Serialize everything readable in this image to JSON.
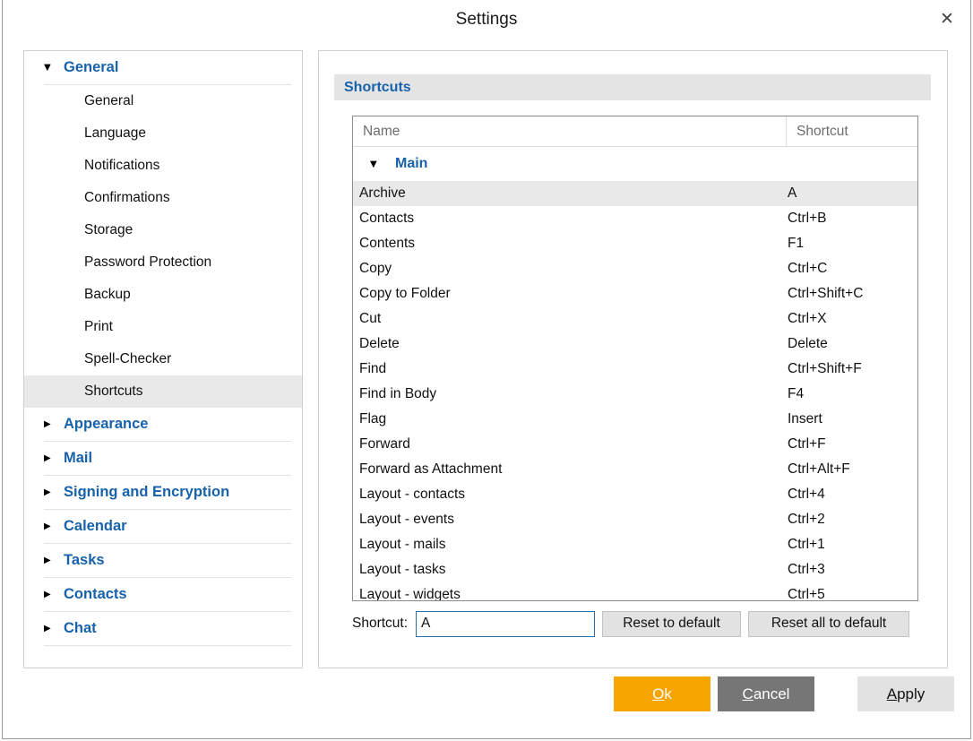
{
  "window": {
    "title": "Settings",
    "close_icon": "close-icon",
    "close_glyph": "✕"
  },
  "sidebar": {
    "groups": [
      {
        "label": "General",
        "expanded": true,
        "triangle": "▼",
        "items": [
          {
            "label": "General",
            "selected": false
          },
          {
            "label": "Language",
            "selected": false
          },
          {
            "label": "Notifications",
            "selected": false
          },
          {
            "label": "Confirmations",
            "selected": false
          },
          {
            "label": "Storage",
            "selected": false
          },
          {
            "label": "Password Protection",
            "selected": false
          },
          {
            "label": "Backup",
            "selected": false
          },
          {
            "label": "Print",
            "selected": false
          },
          {
            "label": "Spell-Checker",
            "selected": false
          },
          {
            "label": "Shortcuts",
            "selected": true
          }
        ]
      },
      {
        "label": "Appearance",
        "expanded": false,
        "triangle": "▶",
        "items": []
      },
      {
        "label": "Mail",
        "expanded": false,
        "triangle": "▶",
        "items": []
      },
      {
        "label": "Signing and Encryption",
        "expanded": false,
        "triangle": "▶",
        "items": []
      },
      {
        "label": "Calendar",
        "expanded": false,
        "triangle": "▶",
        "items": []
      },
      {
        "label": "Tasks",
        "expanded": false,
        "triangle": "▶",
        "items": []
      },
      {
        "label": "Contacts",
        "expanded": false,
        "triangle": "▶",
        "items": []
      },
      {
        "label": "Chat",
        "expanded": false,
        "triangle": "▶",
        "items": []
      }
    ]
  },
  "panel": {
    "header": "Shortcuts",
    "table": {
      "columns": [
        "Name",
        "Shortcut"
      ],
      "group": {
        "label": "Main",
        "triangle": "▼",
        "expanded": true
      },
      "rows": [
        {
          "name": "Archive",
          "shortcut": "A",
          "selected": true
        },
        {
          "name": "Contacts",
          "shortcut": "Ctrl+B",
          "selected": false
        },
        {
          "name": "Contents",
          "shortcut": "F1",
          "selected": false
        },
        {
          "name": "Copy",
          "shortcut": "Ctrl+C",
          "selected": false
        },
        {
          "name": "Copy to Folder",
          "shortcut": "Ctrl+Shift+C",
          "selected": false
        },
        {
          "name": "Cut",
          "shortcut": "Ctrl+X",
          "selected": false
        },
        {
          "name": "Delete",
          "shortcut": "Delete",
          "selected": false
        },
        {
          "name": "Find",
          "shortcut": "Ctrl+Shift+F",
          "selected": false
        },
        {
          "name": "Find in Body",
          "shortcut": "F4",
          "selected": false
        },
        {
          "name": "Flag",
          "shortcut": "Insert",
          "selected": false
        },
        {
          "name": "Forward",
          "shortcut": "Ctrl+F",
          "selected": false
        },
        {
          "name": "Forward as Attachment",
          "shortcut": "Ctrl+Alt+F",
          "selected": false
        },
        {
          "name": "Layout - contacts",
          "shortcut": "Ctrl+4",
          "selected": false
        },
        {
          "name": "Layout - events",
          "shortcut": "Ctrl+2",
          "selected": false
        },
        {
          "name": "Layout - mails",
          "shortcut": "Ctrl+1",
          "selected": false
        },
        {
          "name": "Layout - tasks",
          "shortcut": "Ctrl+3",
          "selected": false
        },
        {
          "name": "Layout - widgets",
          "shortcut": "Ctrl+5",
          "selected": false
        }
      ]
    },
    "editor": {
      "label": "Shortcut:",
      "input_value": "A",
      "input_placeholder": "",
      "reset_button": "Reset to default",
      "reset_all_button": "Reset all to default"
    }
  },
  "footer": {
    "ok": {
      "mnemonic": "O",
      "rest": "k"
    },
    "cancel": {
      "mnemonic": "C",
      "rest": "ancel"
    },
    "apply": {
      "mnemonic": "A",
      "rest": "pply"
    }
  },
  "colors": {
    "accent_blue": "#1862ab",
    "ok_orange": "#f7a501",
    "cancel_gray": "#767676",
    "selection_gray": "#e9e9e9"
  }
}
